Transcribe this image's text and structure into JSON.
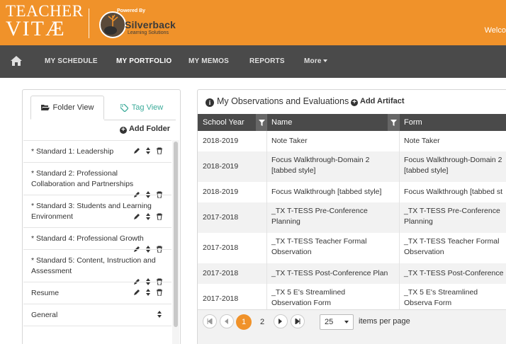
{
  "header": {
    "brand_line1": "TEACHER",
    "brand_line2": "VITÆ",
    "powered_by": "Powered By",
    "partner_name": "Silverback",
    "partner_tagline": "Learning Solutions",
    "welcome": "Welco",
    "accent_color": "#f0922a"
  },
  "nav": {
    "home_icon": "home-icon",
    "items": [
      {
        "label": "MY SCHEDULE"
      },
      {
        "label": "MY PORTFOLIO"
      },
      {
        "label": "MY MEMOS"
      },
      {
        "label": "REPORTS"
      },
      {
        "label": "More"
      }
    ]
  },
  "left_panel": {
    "tabs": [
      {
        "label": "Folder View",
        "icon": "folder-open-icon"
      },
      {
        "label": "Tag View",
        "icon": "tag-icon"
      }
    ],
    "add_folder": "Add Folder",
    "folders": [
      {
        "label": "* Standard 1: Leadership"
      },
      {
        "label": "* Standard 2: Professional Collaboration and Partnerships"
      },
      {
        "label": "* Standard 3: Students and Learning Environment"
      },
      {
        "label": "* Standard 4: Professional Growth"
      },
      {
        "label": "* Standard 5: Content, Instruction and Assessment"
      },
      {
        "label": "Resume"
      },
      {
        "label": "General"
      }
    ]
  },
  "right_panel": {
    "title": "My Observations and Evaluations",
    "add_artifact": "Add Artifact",
    "columns": [
      "School Year",
      "Name",
      "Form"
    ],
    "rows": [
      {
        "year": "2018-2019",
        "name": "Note Taker",
        "form": "Note Taker"
      },
      {
        "year": "2018-2019",
        "name": "Focus Walkthrough-Domain 2 [tabbed style]",
        "form": "Focus Walkthrough-Domain 2 [tabbed style]"
      },
      {
        "year": "2018-2019",
        "name": "Focus Walkthrough [tabbed style]",
        "form": "Focus Walkthrough [tabbed st"
      },
      {
        "year": "2017-2018",
        "name": "_TX T-TESS Pre-Conference Planning",
        "form": "_TX T-TESS Pre-Conference Planning"
      },
      {
        "year": "2017-2018",
        "name": "_TX T-TESS Teacher Formal Observation",
        "form": "_TX T-TESS Teacher Formal Observation"
      },
      {
        "year": "2017-2018",
        "name": "_TX T-TESS Post-Conference Plan",
        "form": "_TX T-TESS Post-Conference"
      },
      {
        "year": "2017-2018",
        "name": "_TX 5 E's Streamlined Observation Form",
        "form": "_TX 5 E's Streamlined Observa Form"
      }
    ],
    "pager": {
      "pages": [
        "1",
        "2"
      ],
      "current_page": "1",
      "page_size": "25",
      "page_size_label": "items per page"
    }
  }
}
